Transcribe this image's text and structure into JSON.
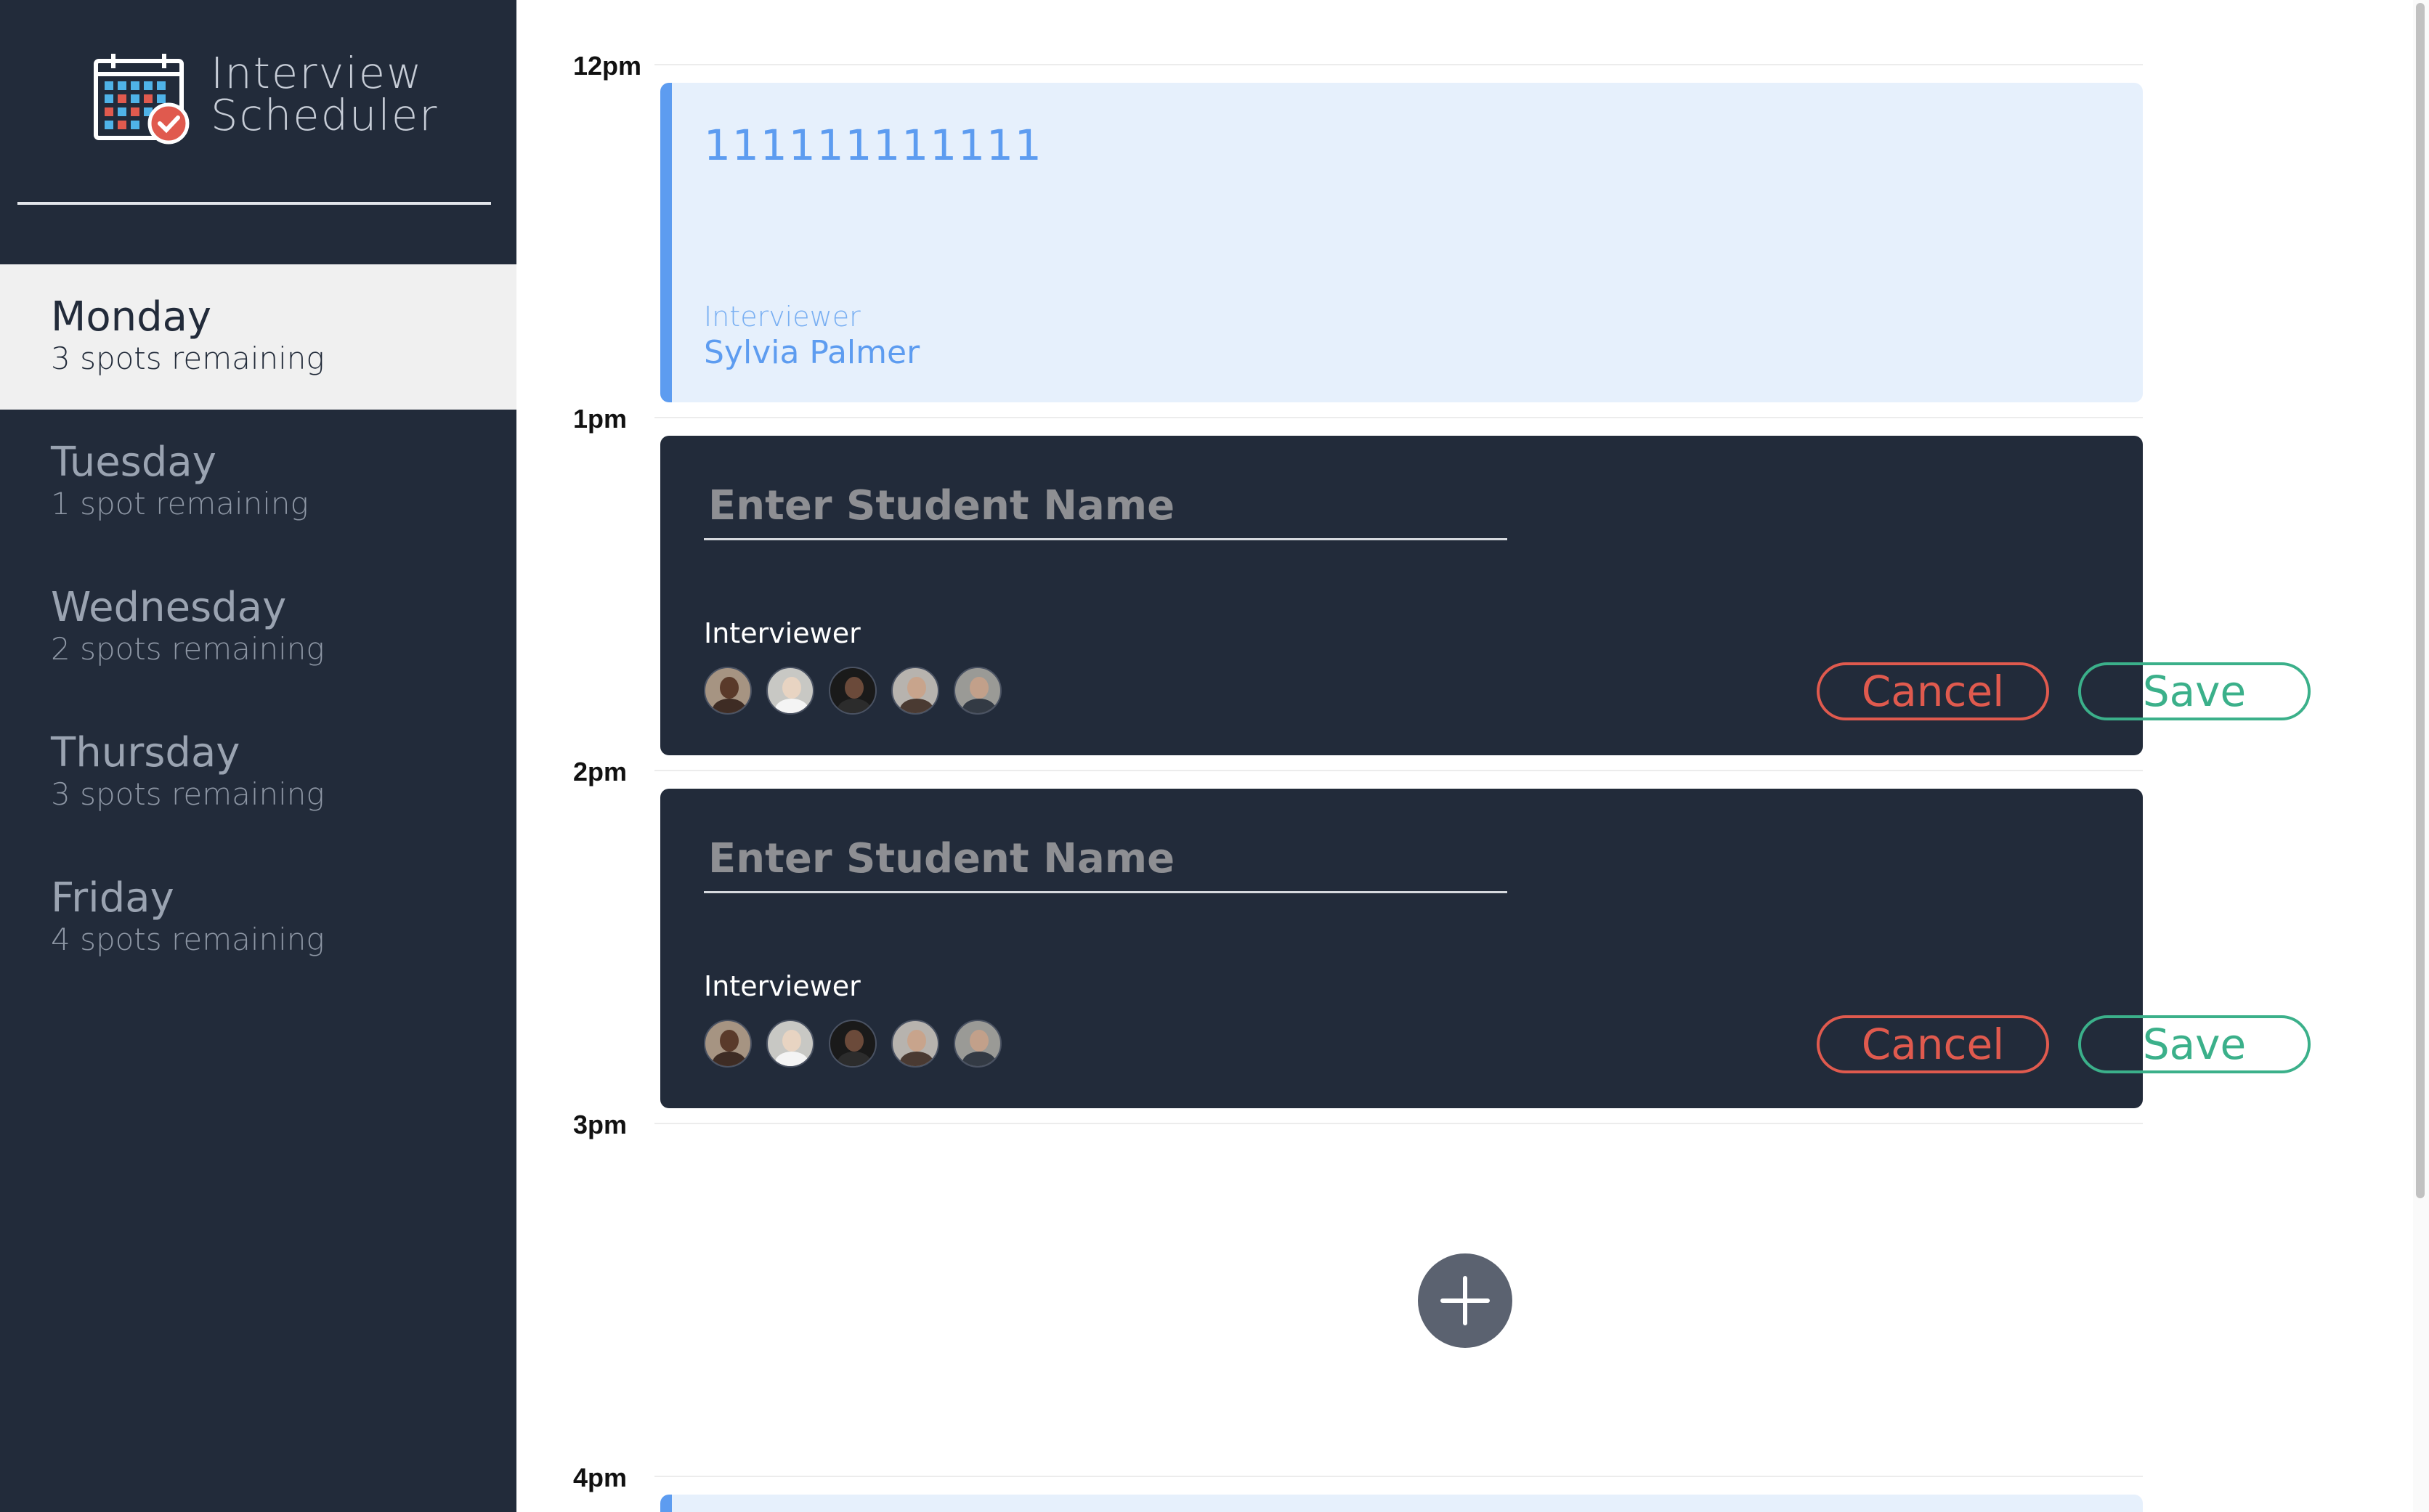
{
  "app": {
    "title_line1": "Interview",
    "title_line2": "Scheduler",
    "logo_icon": "calendar-check-icon"
  },
  "days": [
    {
      "name": "Monday",
      "spots": "3 spots remaining",
      "selected": true
    },
    {
      "name": "Tuesday",
      "spots": "1 spot remaining",
      "selected": false
    },
    {
      "name": "Wednesday",
      "spots": "2 spots remaining",
      "selected": false
    },
    {
      "name": "Thursday",
      "spots": "3 spots remaining",
      "selected": false
    },
    {
      "name": "Friday",
      "spots": "4 spots remaining",
      "selected": false
    }
  ],
  "hours": [
    "12pm",
    "1pm",
    "2pm",
    "3pm",
    "4pm"
  ],
  "appointments": {
    "noon": {
      "student": "111111111111",
      "interviewer_label": "Interviewer",
      "interviewer_name": "Sylvia Palmer"
    },
    "one": {
      "student_placeholder": "Enter Student Name",
      "student_value": "",
      "interviewer_label": "Interviewer",
      "cancel_label": "Cancel",
      "save_label": "Save"
    },
    "two": {
      "student_placeholder": "Enter Student Name",
      "student_value": "",
      "interviewer_label": "Interviewer",
      "cancel_label": "Cancel",
      "save_label": "Save"
    }
  },
  "add_button_icon": "plus-icon",
  "colors": {
    "sidebar_bg": "#222b3a",
    "accent_blue": "#5d9cf0",
    "cancel_red": "#e05a4e",
    "save_green": "#3bb08a"
  }
}
